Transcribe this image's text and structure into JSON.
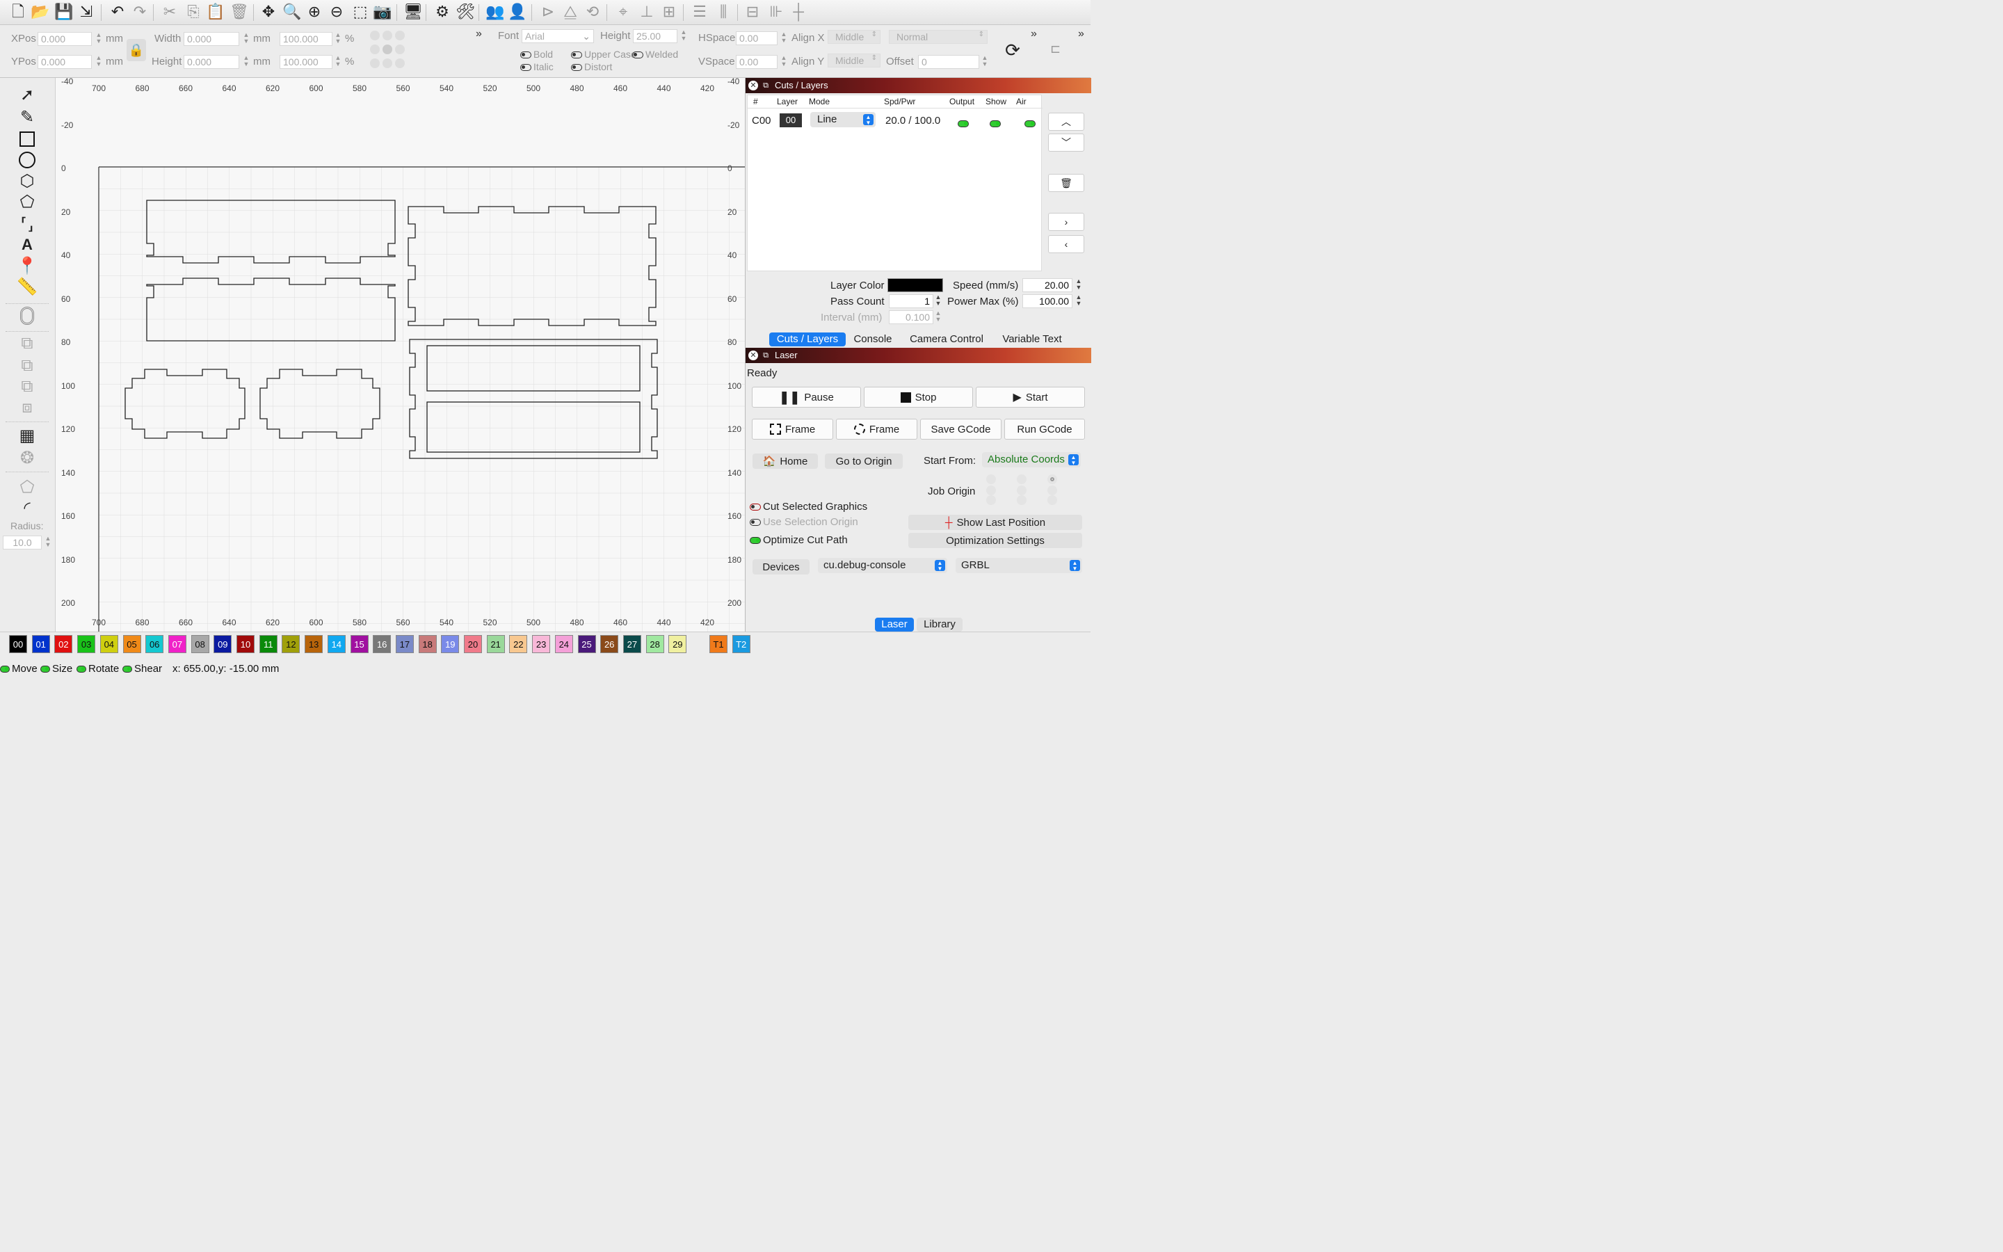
{
  "toolbar": {
    "icons": [
      "new-file-icon",
      "open-folder-icon",
      "save-icon",
      "export-icon",
      "undo-icon",
      "redo-icon",
      "cut-icon",
      "copy-icon",
      "paste-icon",
      "delete-icon",
      "move-icon",
      "zoom-fit-icon",
      "zoom-in-icon",
      "zoom-out-icon",
      "frame-select-icon",
      "camera-icon",
      "monitor-icon",
      "settings-icon",
      "tools-icon",
      "users-icon",
      "user-icon",
      "mirror-h-icon",
      "mirror-v-icon",
      "rotate-icon",
      "target-icon",
      "align-icon",
      "distribute-icon",
      "arrange-icon",
      "dock-icon",
      "grid-icon",
      "crosshair-icon"
    ]
  },
  "props": {
    "xpos_label": "XPos",
    "xpos_value": "0.000",
    "ypos_label": "YPos",
    "ypos_value": "0.000",
    "unit_mm": "mm",
    "width_label": "Width",
    "width_value": "0.000",
    "height_label": "Height",
    "height_value": "0.000",
    "scale_w": "100.000",
    "scale_h": "100.000",
    "unit_pct": "%",
    "font_label": "Font",
    "font_value": "Arial",
    "font_height_label": "Height",
    "font_height_value": "25.00",
    "bold_label": "Bold",
    "italic_label": "Italic",
    "uppercase_label": "Upper Case",
    "distort_label": "Distort",
    "welded_label": "Welded",
    "hspace_label": "HSpace",
    "hspace_value": "0.00",
    "vspace_label": "VSpace",
    "vspace_value": "0.00",
    "alignx_label": "Align X",
    "alignx_value": "Middle",
    "aligny_label": "Align Y",
    "aligny_value": "Middle",
    "normal_value": "Normal",
    "offset_label": "Offset",
    "offset_value": "0",
    "more_glyph": "»"
  },
  "left_tools": {
    "radius_label": "Radius:",
    "radius_value": "10.0"
  },
  "canvas": {
    "x_ticks": [
      "700",
      "680",
      "660",
      "640",
      "620",
      "600",
      "580",
      "560",
      "540",
      "520",
      "500",
      "480",
      "460",
      "440",
      "420"
    ],
    "y_ticks_left": [
      "-40",
      "-20",
      "0",
      "20",
      "40",
      "60",
      "80",
      "100",
      "120",
      "140",
      "160",
      "180",
      "200"
    ],
    "y_ticks_right": [
      "-40",
      "-20",
      "0",
      "20",
      "40",
      "60",
      "80",
      "100",
      "120",
      "140",
      "160",
      "180",
      "200"
    ]
  },
  "cuts": {
    "title": "Cuts / Layers",
    "headers": [
      "#",
      "Layer",
      "Mode",
      "Spd/Pwr",
      "Output",
      "Show",
      "Air"
    ],
    "row": {
      "id": "C00",
      "layer": "00",
      "mode": "Line",
      "spdpwr": "20.0 / 100.0"
    },
    "layer_color_label": "Layer Color",
    "layer_color": "#000000",
    "speed_label": "Speed (mm/s)",
    "speed_value": "20.00",
    "pass_label": "Pass Count",
    "pass_value": "1",
    "power_label": "Power Max (%)",
    "power_value": "100.00",
    "interval_label": "Interval (mm)",
    "interval_value": "0.100",
    "tabs": [
      "Cuts / Layers",
      "Console",
      "Camera Control",
      "Variable Text"
    ]
  },
  "laser": {
    "title": "Laser",
    "status": "Ready",
    "pause": "Pause",
    "stop": "Stop",
    "start": "Start",
    "frame1": "Frame",
    "frame2": "Frame",
    "save_gcode": "Save GCode",
    "run_gcode": "Run GCode",
    "home": "Home",
    "go_origin": "Go to Origin",
    "start_from_label": "Start From:",
    "start_from_value": "Absolute Coords",
    "job_origin_label": "Job Origin",
    "cut_selected": "Cut Selected Graphics",
    "use_selection_origin": "Use Selection Origin",
    "optimize_cut_path": "Optimize Cut Path",
    "show_last_position": "Show Last Position",
    "optimization_settings": "Optimization Settings",
    "devices": "Devices",
    "device_value": "cu.debug-console",
    "firmware_value": "GRBL",
    "bottom_tabs": [
      "Laser",
      "Library"
    ]
  },
  "palette": [
    {
      "label": "00",
      "color": "#000000",
      "text": "#ffffff"
    },
    {
      "label": "01",
      "color": "#0033cc",
      "text": "#ffffff"
    },
    {
      "label": "02",
      "color": "#e01010",
      "text": "#ffffff"
    },
    {
      "label": "03",
      "color": "#19c219",
      "text": "#111111"
    },
    {
      "label": "04",
      "color": "#cfcf10",
      "text": "#111111"
    },
    {
      "label": "05",
      "color": "#f08a18",
      "text": "#111111"
    },
    {
      "label": "06",
      "color": "#14c8d0",
      "text": "#111111"
    },
    {
      "label": "07",
      "color": "#f021c8",
      "text": "#ffffff"
    },
    {
      "label": "08",
      "color": "#a8a8a8",
      "text": "#111111"
    },
    {
      "label": "09",
      "color": "#0a1aa0",
      "text": "#ffffff"
    },
    {
      "label": "10",
      "color": "#a00a0a",
      "text": "#ffffff"
    },
    {
      "label": "11",
      "color": "#0a8a0a",
      "text": "#ffffff"
    },
    {
      "label": "12",
      "color": "#a0a00a",
      "text": "#111111"
    },
    {
      "label": "13",
      "color": "#b8640a",
      "text": "#111111"
    },
    {
      "label": "14",
      "color": "#10a8f0",
      "text": "#ffffff"
    },
    {
      "label": "15",
      "color": "#a010a0",
      "text": "#ffffff"
    },
    {
      "label": "16",
      "color": "#787878",
      "text": "#ffffff"
    },
    {
      "label": "17",
      "color": "#7a8ac8",
      "text": "#111111"
    },
    {
      "label": "18",
      "color": "#c87a7a",
      "text": "#111111"
    },
    {
      "label": "19",
      "color": "#7a8ae8",
      "text": "#ffffff"
    },
    {
      "label": "20",
      "color": "#f07a8a",
      "text": "#111111"
    },
    {
      "label": "21",
      "color": "#9ad89a",
      "text": "#111111"
    },
    {
      "label": "22",
      "color": "#f8c890",
      "text": "#111111"
    },
    {
      "label": "23",
      "color": "#f8b8d8",
      "text": "#111111"
    },
    {
      "label": "24",
      "color": "#f4a0d8",
      "text": "#111111"
    },
    {
      "label": "25",
      "color": "#4a1a7a",
      "text": "#ffffff"
    },
    {
      "label": "26",
      "color": "#8a4a1a",
      "text": "#ffffff"
    },
    {
      "label": "27",
      "color": "#0a4a4a",
      "text": "#ffffff"
    },
    {
      "label": "28",
      "color": "#a0e8a0",
      "text": "#111111"
    },
    {
      "label": "29",
      "color": "#f0f0a0",
      "text": "#111111"
    },
    {
      "label": "T1",
      "color": "#f07a1a",
      "text": "#111111"
    },
    {
      "label": "T2",
      "color": "#1a9ae0",
      "text": "#ffffff"
    }
  ],
  "status": {
    "move": "Move",
    "size": "Size",
    "rotate": "Rotate",
    "shear": "Shear",
    "coords": "x: 655.00,y: -15.00 mm"
  }
}
